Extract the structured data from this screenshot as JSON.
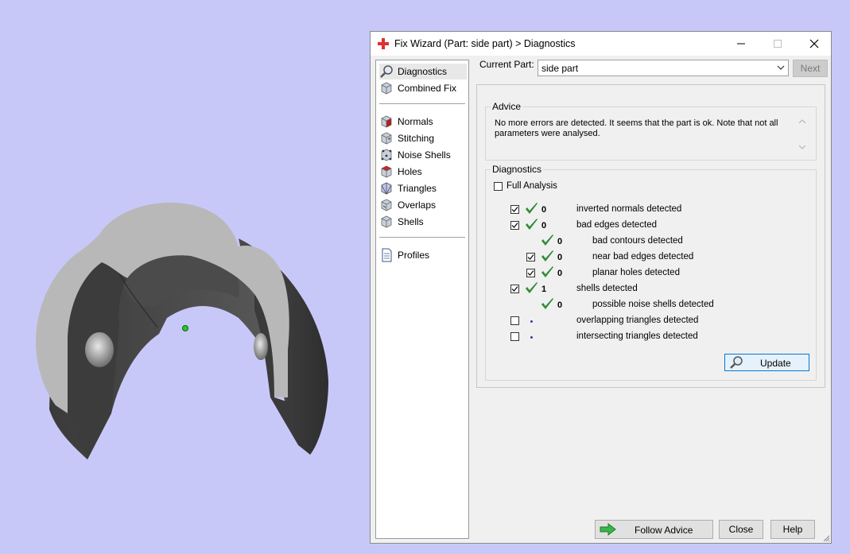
{
  "window": {
    "title": "Fix Wizard (Part: side part) > Diagnostics"
  },
  "sidebar": {
    "items": [
      {
        "label": "Diagnostics",
        "icon": "magnifier-icon"
      },
      {
        "label": "Combined Fix",
        "icon": "cube-icon"
      },
      {
        "label": "Normals",
        "icon": "normals-cube-icon"
      },
      {
        "label": "Stitching",
        "icon": "stitching-cube-icon"
      },
      {
        "label": "Noise Shells",
        "icon": "noise-shells-icon"
      },
      {
        "label": "Holes",
        "icon": "holes-cube-icon"
      },
      {
        "label": "Triangles",
        "icon": "triangles-icon"
      },
      {
        "label": "Overlaps",
        "icon": "overlaps-cube-icon"
      },
      {
        "label": "Shells",
        "icon": "shells-cube-icon"
      },
      {
        "label": "Profiles",
        "icon": "document-icon"
      }
    ]
  },
  "current_part": {
    "label": "Current Part:",
    "value": "side part",
    "next_label": "Next"
  },
  "advice": {
    "title": "Advice",
    "text": "No more errors are detected. It seems that the part is ok. Note that not all parameters were analysed."
  },
  "diagnostics": {
    "title": "Diagnostics",
    "full_analysis_label": "Full Analysis",
    "full_analysis_checked": false,
    "rows": [
      {
        "label": "inverted normals detected",
        "count": "0",
        "checked": true,
        "status": "ok"
      },
      {
        "label": "bad edges detected",
        "count": "0",
        "checked": true,
        "status": "ok"
      },
      {
        "label": "bad contours detected",
        "count": "0",
        "checked": null,
        "status": "ok"
      },
      {
        "label": "near bad edges detected",
        "count": "0",
        "checked": true,
        "status": "ok"
      },
      {
        "label": "planar holes detected",
        "count": "0",
        "checked": true,
        "status": "ok"
      },
      {
        "label": "shells detected",
        "count": "1",
        "checked": true,
        "status": "ok"
      },
      {
        "label": "possible noise shells detected",
        "count": "0",
        "checked": null,
        "status": "ok"
      },
      {
        "label": "overlapping triangles detected",
        "count": "",
        "checked": false,
        "status": "pending"
      },
      {
        "label": "intersecting triangles detected",
        "count": "",
        "checked": false,
        "status": "pending"
      }
    ]
  },
  "buttons": {
    "update": "Update",
    "follow_advice": "Follow Advice",
    "close": "Close",
    "help": "Help"
  },
  "colors": {
    "viewport_background": "#c8c8f8",
    "check_green": "#2e8b3a",
    "pending_dot": "#2b3fb0",
    "title_icon_red": "#e03030"
  }
}
